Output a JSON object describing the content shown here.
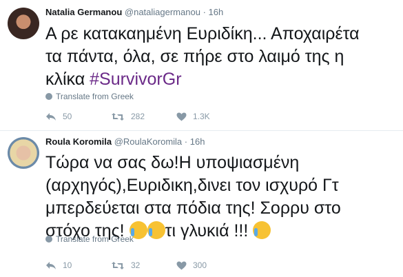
{
  "tweets": [
    {
      "name": "Natalia Germanou",
      "handle": "@nataliagermanou",
      "separator": "·",
      "time": "16h",
      "text_line_1": "Α ρε κατακαημένη Ευριδίκη... Αποχαιρέτα",
      "text_line_2": "τα πάντα, όλα, σε πήρε στο λαιμό της η",
      "text_line_3_prefix": "κλίκα ",
      "hashtag": "#SurvivorGr",
      "translate": "Translate from Greek",
      "replies": "50",
      "retweets": "282",
      "likes": "1.3K"
    },
    {
      "name": "Roula Koromila",
      "handle": "@RoulaKoromila",
      "separator": "·",
      "time": "16h",
      "text_line_1": "Τώρα να σας δω!Η υποψιασμένη",
      "text_line_2": "(αρχηγός),Ευριδικη,δινει τον ισχυρό Γτ",
      "text_line_3": "μπερδεύεται στα πόδια της! Σορρυ στο",
      "text_line_4_prefix": "στόχο της! ",
      "text_line_4_mid": "τι γλυκιά !!! ",
      "translate": "Translate from Greek",
      "replies": "10",
      "retweets": "32",
      "likes": "300"
    }
  ],
  "icons": {
    "reply": "reply-icon",
    "retweet": "retweet-icon",
    "like": "heart-icon",
    "globe": "globe-icon",
    "emoji": "face-with-tears-of-joy-icon"
  },
  "colors": {
    "hashtag": "#6b2a88",
    "muted": "#657786",
    "icon": "#8899a6"
  }
}
